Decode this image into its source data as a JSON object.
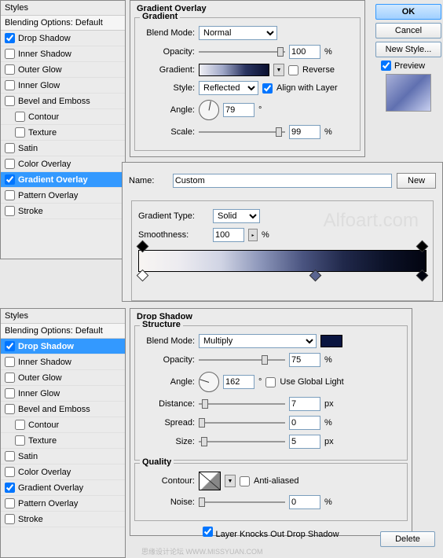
{
  "top_panel": {
    "header": "Styles",
    "blending": "Blending Options: Default",
    "items": [
      {
        "label": "Drop Shadow",
        "checked": true
      },
      {
        "label": "Inner Shadow",
        "checked": false
      },
      {
        "label": "Outer Glow",
        "checked": false
      },
      {
        "label": "Inner Glow",
        "checked": false
      },
      {
        "label": "Bevel and Emboss",
        "checked": false
      },
      {
        "label": "Contour",
        "checked": false,
        "indent": true
      },
      {
        "label": "Texture",
        "checked": false,
        "indent": true
      },
      {
        "label": "Satin",
        "checked": false
      },
      {
        "label": "Color Overlay",
        "checked": false
      },
      {
        "label": "Gradient Overlay",
        "checked": true,
        "selected": true
      },
      {
        "label": "Pattern Overlay",
        "checked": false
      },
      {
        "label": "Stroke",
        "checked": false
      }
    ]
  },
  "gradient_overlay": {
    "title": "Gradient Overlay",
    "subtitle": "Gradient",
    "blend_mode_label": "Blend Mode:",
    "blend_mode": "Normal",
    "opacity_label": "Opacity:",
    "opacity": "100",
    "percent": "%",
    "gradient_label": "Gradient:",
    "reverse_label": "Reverse",
    "style_label": "Style:",
    "style": "Reflected",
    "align_label": "Align with Layer",
    "angle_label": "Angle:",
    "angle": "79",
    "degree": "°",
    "scale_label": "Scale:",
    "scale": "99"
  },
  "right": {
    "ok": "OK",
    "cancel": "Cancel",
    "new_style": "New Style...",
    "preview": "Preview"
  },
  "gradient_editor": {
    "name_label": "Name:",
    "name": "Custom",
    "new_btn": "New",
    "type_label": "Gradient Type:",
    "type": "Solid",
    "smoothness_label": "Smoothness:",
    "smoothness": "100",
    "percent": "%"
  },
  "watermark": "Alfoart.com",
  "sub_watermark": "思缘设计论坛    WWW.MISSYUAN.COM",
  "bottom_panel": {
    "header": "Styles",
    "blending": "Blending Options: Default",
    "items": [
      {
        "label": "Drop Shadow",
        "checked": true,
        "selected": true
      },
      {
        "label": "Inner Shadow",
        "checked": false
      },
      {
        "label": "Outer Glow",
        "checked": false
      },
      {
        "label": "Inner Glow",
        "checked": false
      },
      {
        "label": "Bevel and Emboss",
        "checked": false
      },
      {
        "label": "Contour",
        "checked": false,
        "indent": true
      },
      {
        "label": "Texture",
        "checked": false,
        "indent": true
      },
      {
        "label": "Satin",
        "checked": false
      },
      {
        "label": "Color Overlay",
        "checked": false
      },
      {
        "label": "Gradient Overlay",
        "checked": true
      },
      {
        "label": "Pattern Overlay",
        "checked": false
      },
      {
        "label": "Stroke",
        "checked": false
      }
    ]
  },
  "drop_shadow": {
    "title": "Drop Shadow",
    "structure": "Structure",
    "blend_mode_label": "Blend Mode:",
    "blend_mode": "Multiply",
    "opacity_label": "Opacity:",
    "opacity": "75",
    "percent": "%",
    "angle_label": "Angle:",
    "angle": "162",
    "degree": "°",
    "global_light": "Use Global Light",
    "distance_label": "Distance:",
    "distance": "7",
    "px": "px",
    "spread_label": "Spread:",
    "spread": "0",
    "size_label": "Size:",
    "size": "5",
    "quality": "Quality",
    "contour_label": "Contour:",
    "antialiased": "Anti-aliased",
    "noise_label": "Noise:",
    "noise": "0",
    "knockout": "Layer Knocks Out Drop Shadow"
  },
  "delete_btn": "Delete"
}
